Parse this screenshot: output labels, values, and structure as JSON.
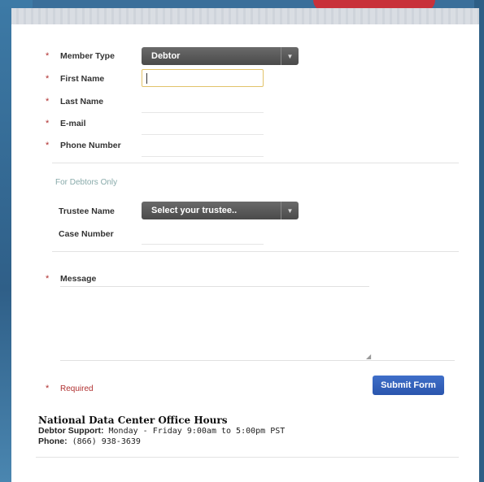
{
  "form": {
    "member_type_label": "Member Type",
    "member_type_value": "Debtor",
    "first_name_label": "First Name",
    "last_name_label": "Last Name",
    "email_label": "E-mail",
    "phone_label": "Phone Number",
    "debtors_section_title": "For Debtors Only",
    "trustee_label": "Trustee Name",
    "trustee_placeholder": "Select your trustee..",
    "case_number_label": "Case Number",
    "message_label": "Message",
    "required_label": "Required",
    "submit_label": "Submit Form",
    "required_marker": "*"
  },
  "office": {
    "title": "National Data Center Office Hours",
    "support_label": "Debtor Support:",
    "support_value": " Monday - Friday 9:00am to 5:00pm PST",
    "phone_label": "Phone:",
    "phone_value": " (866) 938-3639"
  },
  "colors": {
    "accent": "#2a55ad",
    "required": "#b03030",
    "select_bg": "#4a4a4a"
  }
}
